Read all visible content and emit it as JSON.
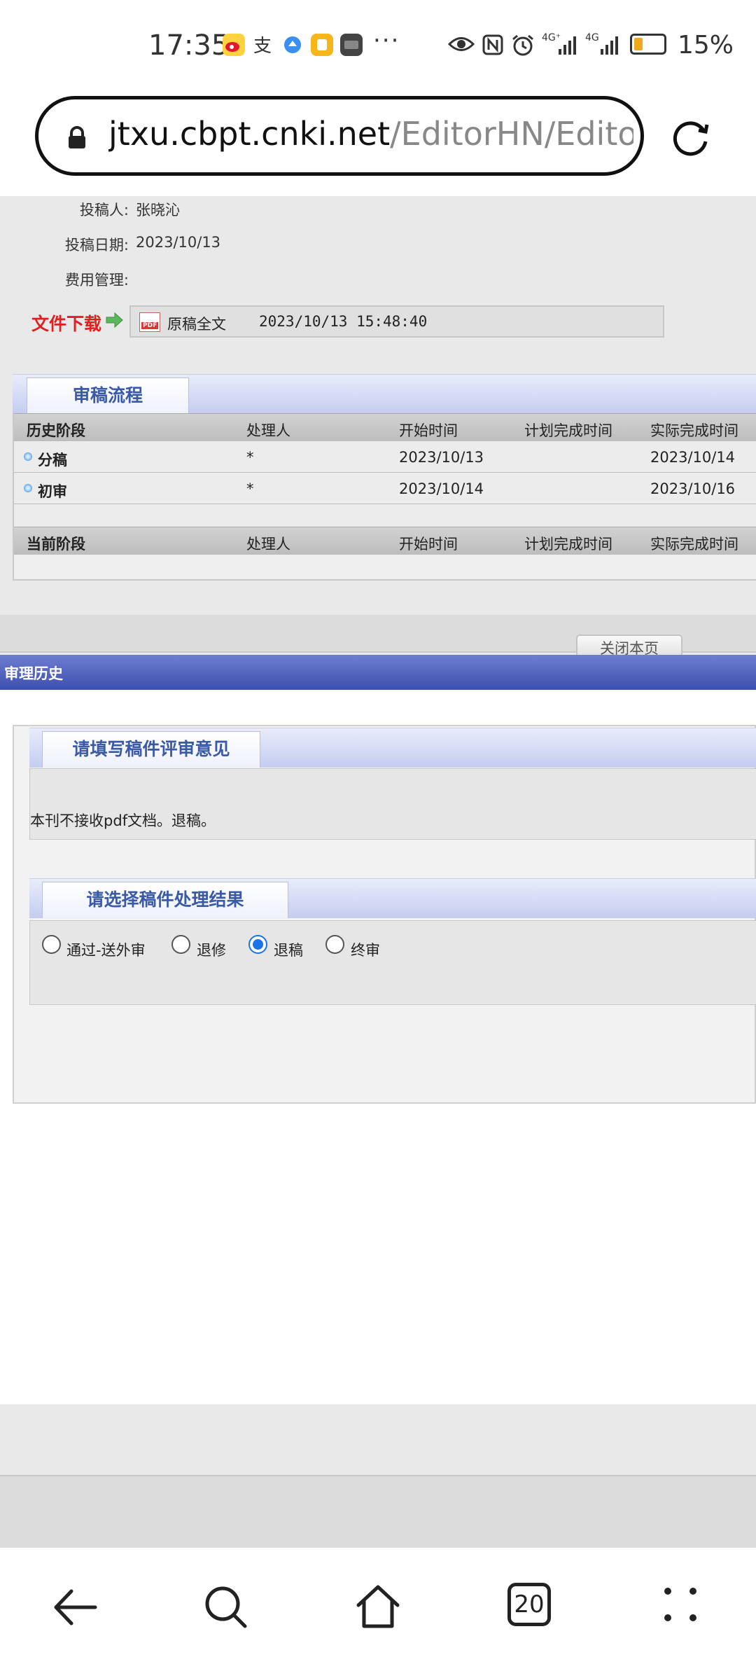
{
  "status_bar": {
    "time": "17:35",
    "battery": "15%",
    "network_1": "4G⁺",
    "network_2": "4G"
  },
  "browser": {
    "url_host": "jtxu.cbpt.cnki.net",
    "url_path": "/EditorHN/Editor",
    "tab_count": "20"
  },
  "manuscript": {
    "author_label": "投稿人:",
    "author": "张晓沁",
    "date_label": "投稿日期:",
    "date": "2023/10/13",
    "fee_label": "费用管理:",
    "fee": "",
    "download_label": "文件下载",
    "file_name": "原稿全文",
    "file_datetime": "2023/10/13  15:48:40"
  },
  "workflow": {
    "tab": "审稿流程",
    "history_headers": [
      "历史阶段",
      "处理人",
      "开始时间",
      "计划完成时间",
      "实际完成时间"
    ],
    "rows": [
      {
        "stage": "分稿",
        "handler": "*",
        "start": "2023/10/13",
        "planned": "",
        "actual": "2023/10/14"
      },
      {
        "stage": "初审",
        "handler": "*",
        "start": "2023/10/14",
        "planned": "",
        "actual": "2023/10/16"
      }
    ],
    "current_headers": [
      "当前阶段",
      "处理人",
      "开始时间",
      "计划完成时间",
      "实际完成时间"
    ],
    "close_button": "关闭本页"
  },
  "review": {
    "section_title": "审理历史",
    "comment_tab": "请填写稿件评审意见",
    "comment_text": "本刊不接收pdf文档。退稿。",
    "result_tab": "请选择稿件处理结果",
    "options": [
      "通过-送外审",
      "退修",
      "退稿",
      "终审"
    ],
    "selected": "退稿"
  }
}
